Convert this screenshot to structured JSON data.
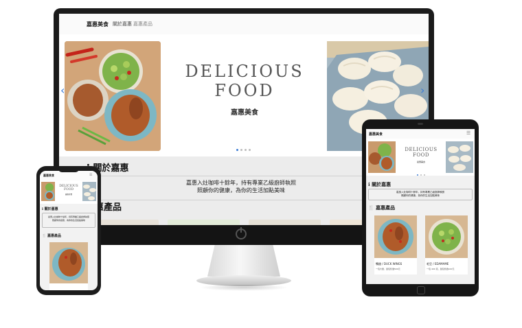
{
  "site": {
    "brand": "嘉惠美食",
    "nav_links": [
      "關於嘉惠",
      "嘉惠產品"
    ],
    "hero_title_line1": "DELICIOUS",
    "hero_title_line2": "FOOD",
    "hero_subtitle": "嘉惠美食",
    "about_heading": "關於嘉惠",
    "about_line1": "嘉惠入灶咖啡十餘年，持有專業乙級廚師執照",
    "about_line2": "照顧你的健康，為你的生活加點美味",
    "products_heading": "嘉惠產品",
    "products_heading_partial": "惠產品",
    "products": [
      {
        "name": "鴨翅 / DUCK WINGS",
        "desc": "一包大量，單包售價500元"
      },
      {
        "name": "毛豆 / EDAMAME",
        "desc": "一包 400 克，單包售價100元"
      }
    ]
  },
  "colors": {
    "accent": "#3a7bd5",
    "monitor_frame": "#1b1b1b",
    "page_bg": "#ececec"
  },
  "icons": [
    "info-icon",
    "utensils-icon",
    "hamburger-icon",
    "chevron-left-icon",
    "chevron-right-icon",
    "power-icon"
  ]
}
